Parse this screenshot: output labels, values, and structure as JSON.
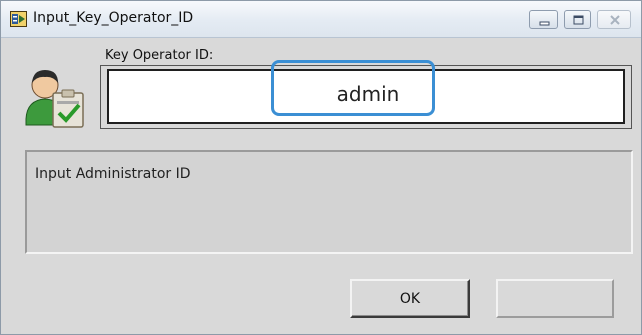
{
  "window": {
    "title": "Input_Key_Operator_ID"
  },
  "icons": {
    "app": "labview-app-icon",
    "user": "operator-clipboard-icon",
    "minimize": "minimize-icon",
    "maximize": "maximize-icon",
    "close": "close-icon"
  },
  "form": {
    "label": "Key Operator ID:",
    "value": "admin"
  },
  "message": {
    "text": "Input Administrator ID"
  },
  "buttons": {
    "ok_label": "OK",
    "second_label": ""
  },
  "colors": {
    "window_background": "#d9d9d9",
    "highlight": "#3b8fd4",
    "titlebar": "#e4ebf3"
  }
}
